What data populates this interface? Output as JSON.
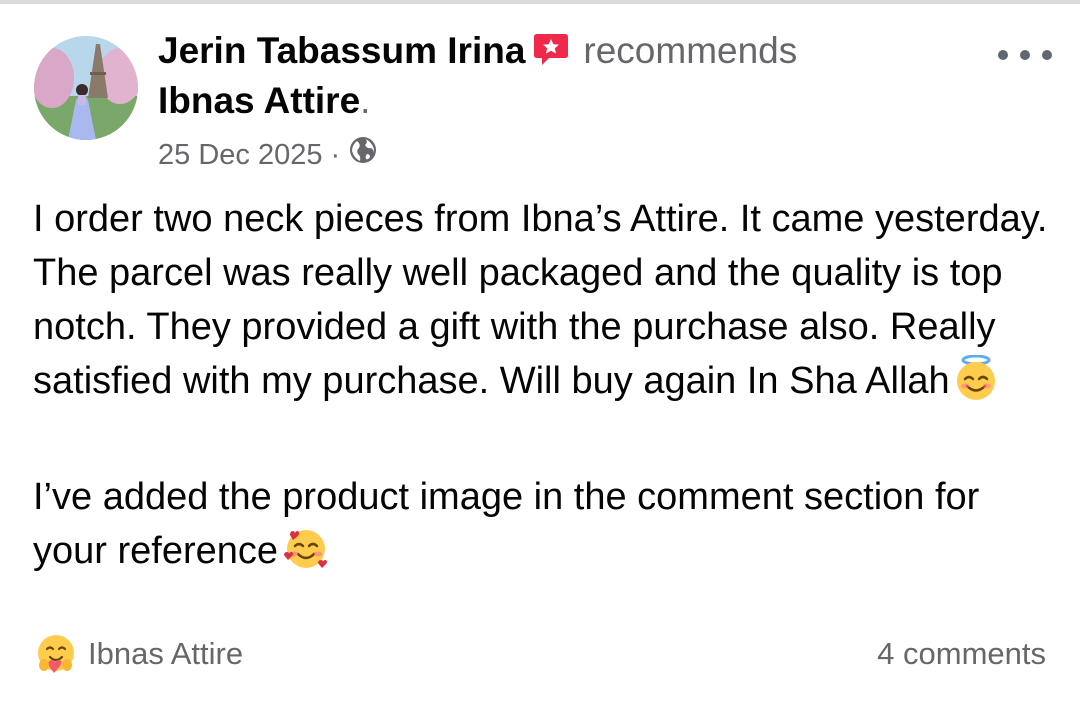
{
  "post": {
    "author": "Jerin Tabassum Irina",
    "verb": "recommends",
    "page": "Ibnas Attire",
    "period": ".",
    "date": "25 Dec 2025",
    "separator": "·",
    "body_paragraph_1": "I order two neck pieces from Ibna’s Attire. It came yesterday. The parcel was really well packaged and the quality is top notch. They provided a gift with the purchase also. Really satisfied with my purchase. Will buy again In Sha Allah",
    "body_paragraph_2": "I’ve added the product image in the comment section for your reference",
    "reaction_name": "Ibnas Attire",
    "comments": "4 comments"
  },
  "icons": {
    "badge": "recommendation-badge-icon",
    "privacy": "globe-icon",
    "more": "more-options-icon",
    "emoji_1": "smiling-face-with-halo-icon",
    "emoji_2": "smiling-face-with-hearts-icon",
    "reaction": "hugging-face-icon"
  },
  "colors": {
    "primary_text": "#050505",
    "secondary_text": "#65676b",
    "badge": "#f02849",
    "emoji_yellow": "#ffcc4d"
  }
}
